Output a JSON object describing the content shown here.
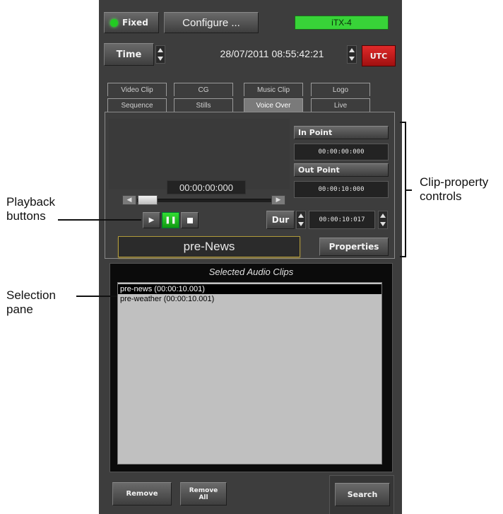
{
  "top_bar": {
    "fixed_label": "Fixed",
    "configure_label": "Configure ...",
    "channel_label": "iTX-4"
  },
  "time_row": {
    "time_label": "Time",
    "datetime": "28/07/2011 08:55:42:21",
    "utc_label": "UTC"
  },
  "tabs": {
    "row1": [
      "Video Clip",
      "CG",
      "Music Clip",
      "Logo"
    ],
    "row2": [
      "Sequence",
      "Stills",
      "Voice Over",
      "Live"
    ],
    "active": "Voice Over"
  },
  "clip_panel": {
    "in_point_label": "In Point",
    "in_point_value": "00:00:00:000",
    "out_point_label": "Out Point",
    "out_point_value": "00:00:10:000",
    "timecode": "00:00:00:000",
    "dur_label": "Dur",
    "dur_value": "00:00:10:017",
    "clip_name": "pre-News",
    "properties_label": "Properties"
  },
  "selection": {
    "title": "Selected Audio Clips",
    "items": [
      "pre-news (00:00:10.001)",
      "pre-weather (00:00:10.001)"
    ],
    "selected_index": 0
  },
  "bottom": {
    "remove_label": "Remove",
    "remove_all_label": "Remove All",
    "search_label": "Search"
  },
  "annotations": {
    "clip_property_controls": "Clip-property controls",
    "playback_buttons": "Playback buttons",
    "selection_pane": "Selection pane"
  },
  "colors": {
    "panel": "#3d3d3d",
    "status_green": "#33cc33",
    "utc_red": "#cc1a1a",
    "play_active_green": "#22bb22",
    "list_bg": "#c0c0c0"
  }
}
